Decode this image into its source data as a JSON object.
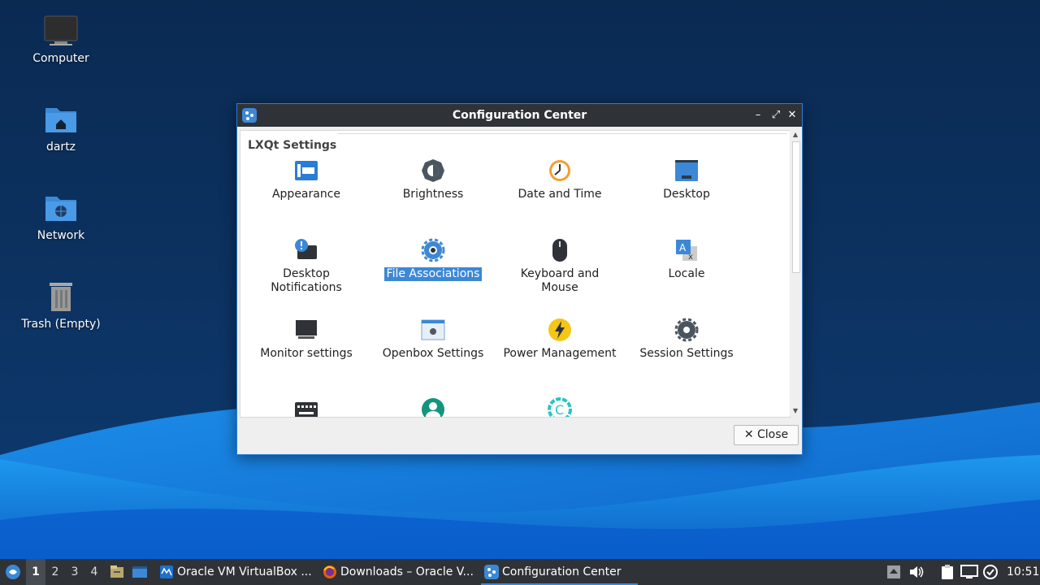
{
  "desktop": {
    "icons": [
      {
        "label": "Computer"
      },
      {
        "label": "dartz"
      },
      {
        "label": "Network"
      },
      {
        "label": "Trash (Empty)"
      }
    ]
  },
  "window": {
    "title": "Configuration Center",
    "section_title": "LXQt Settings",
    "items": [
      {
        "label": "Appearance",
        "icon": "appearance-icon"
      },
      {
        "label": "Brightness",
        "icon": "brightness-icon"
      },
      {
        "label": "Date and Time",
        "icon": "clock-icon"
      },
      {
        "label": "Desktop",
        "icon": "desktop-icon"
      },
      {
        "label": "Desktop Notifications",
        "icon": "notification-icon"
      },
      {
        "label": "File Associations",
        "icon": "gear-icon",
        "selected": true
      },
      {
        "label": "Keyboard and Mouse",
        "icon": "mouse-icon"
      },
      {
        "label": "Locale",
        "icon": "locale-icon"
      },
      {
        "label": "Monitor settings",
        "icon": "monitor-icon"
      },
      {
        "label": "Openbox Settings",
        "icon": "openbox-icon"
      },
      {
        "label": "Power Management",
        "icon": "power-icon"
      },
      {
        "label": "Session Settings",
        "icon": "session-gear-icon"
      }
    ],
    "close_label": "Close"
  },
  "taskbar": {
    "workspaces": [
      "1",
      "2",
      "3",
      "4"
    ],
    "active_workspace": "1",
    "tasks": [
      {
        "label": "Oracle VM VirtualBox ..."
      },
      {
        "label": "Downloads – Oracle V..."
      },
      {
        "label": "Configuration Center"
      }
    ],
    "clock": "10:51"
  },
  "colors": {
    "desktop_bg": "#0b2b52",
    "wave_light": "#1e8ee8",
    "accent": "#3c88d6",
    "titlebar": "#2f3338"
  }
}
